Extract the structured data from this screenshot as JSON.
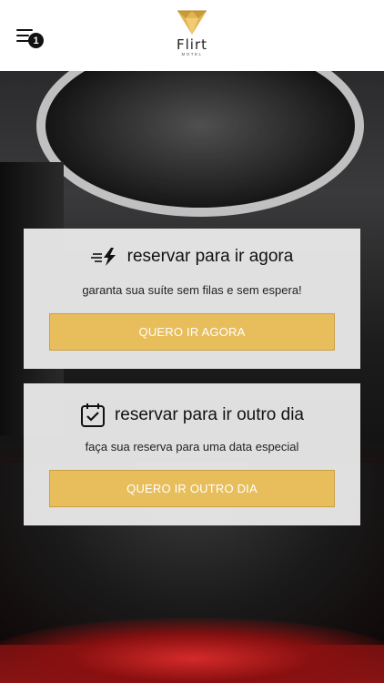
{
  "header": {
    "menu_badge": "1",
    "logo_name": "Flirt",
    "logo_sub": "MOTEL"
  },
  "cards": {
    "now": {
      "icon": "fast-lightning-icon",
      "title": "reservar para ir agora",
      "subtitle": "garanta sua suíte sem filas e sem espera!",
      "button": "QUERO IR AGORA"
    },
    "later": {
      "icon": "calendar-check-icon",
      "title": "reservar para ir outro dia",
      "subtitle": "faça sua reserva para uma data especial",
      "button": "QUERO IR OUTRO DIA"
    }
  },
  "colors": {
    "accent": "#e8be5c",
    "header_bg": "#ffffff",
    "card_bg": "#e8e8e8"
  }
}
